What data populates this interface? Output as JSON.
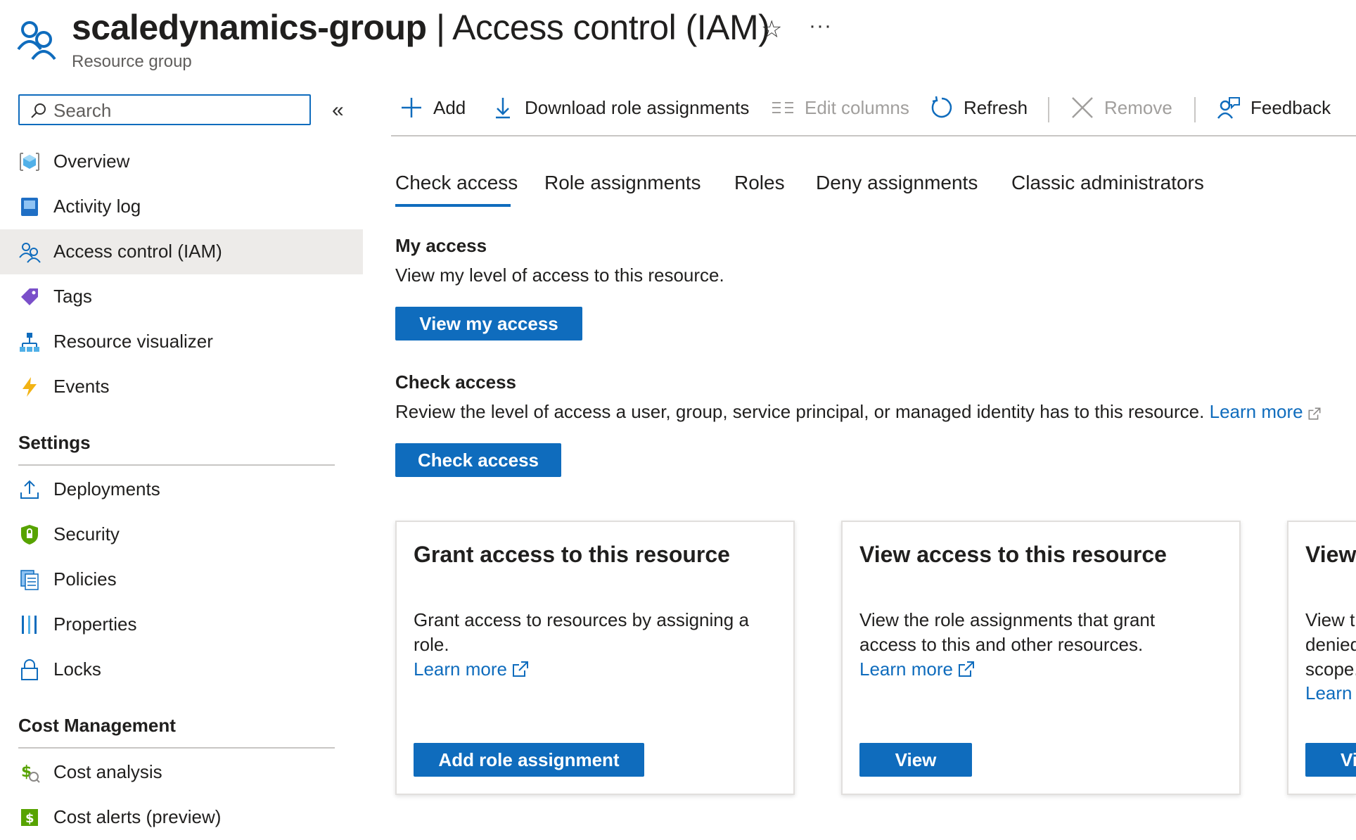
{
  "header": {
    "title_resource": "scaledynamics-group",
    "title_sep": " | ",
    "title_page": "Access control (IAM)",
    "subtitle": "Resource group",
    "star": "☆",
    "more": "···"
  },
  "sidebar": {
    "search_placeholder": "Search",
    "collapse": "«",
    "items": [
      {
        "label": "Overview",
        "icon": "resource-group-cube-icon"
      },
      {
        "label": "Activity log",
        "icon": "activity-log-icon"
      },
      {
        "label": "Access control (IAM)",
        "icon": "people-icon",
        "active": true
      },
      {
        "label": "Tags",
        "icon": "tag-icon"
      },
      {
        "label": "Resource visualizer",
        "icon": "hierarchy-icon"
      },
      {
        "label": "Events",
        "icon": "lightning-icon"
      }
    ],
    "settings_header": "Settings",
    "settings_items": [
      {
        "label": "Deployments",
        "icon": "upload-icon"
      },
      {
        "label": "Security",
        "icon": "shield-icon"
      },
      {
        "label": "Policies",
        "icon": "policy-icon"
      },
      {
        "label": "Properties",
        "icon": "properties-bars-icon"
      },
      {
        "label": "Locks",
        "icon": "lock-icon"
      }
    ],
    "cost_header": "Cost Management",
    "cost_items": [
      {
        "label": "Cost analysis",
        "icon": "cost-analysis-icon"
      },
      {
        "label": "Cost alerts (preview)",
        "icon": "cost-alerts-icon"
      }
    ]
  },
  "toolbar": {
    "add": "Add",
    "download": "Download role assignments",
    "edit_columns": "Edit columns",
    "refresh": "Refresh",
    "remove": "Remove",
    "feedback": "Feedback"
  },
  "tabs": [
    "Check access",
    "Role assignments",
    "Roles",
    "Deny assignments",
    "Classic administrators"
  ],
  "my_access": {
    "title": "My access",
    "desc": "View my level of access to this resource.",
    "button": "View my access"
  },
  "check_access": {
    "title": "Check access",
    "desc": "Review the level of access a user, group, service principal, or managed identity has to this resource.",
    "link": "Learn more",
    "button": "Check access"
  },
  "cards": [
    {
      "title": "Grant access to this resource",
      "desc": "Grant access to resources by assigning a role.",
      "link": "Learn more",
      "button": "Add role assignment"
    },
    {
      "title": "View access to this resource",
      "desc": "View the role assignments that grant access to this and other resources.",
      "link": "Learn more",
      "button": "View"
    },
    {
      "title": "View",
      "desc": "View t denied scope.",
      "link": "Learn",
      "button": "Vi"
    }
  ],
  "colors": {
    "accent": "#0f6cbd",
    "active_bg": "#edebe9",
    "divider": "#c8c6c4"
  }
}
